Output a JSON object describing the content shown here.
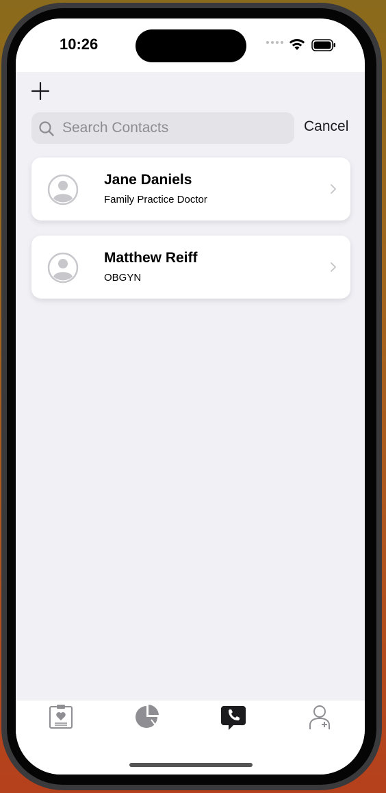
{
  "status": {
    "time": "10:26"
  },
  "search": {
    "placeholder": "Search Contacts",
    "cancel_label": "Cancel"
  },
  "contacts": [
    {
      "name": "Jane Daniels",
      "subtitle": "Family Practice Doctor"
    },
    {
      "name": "Matthew Reiff",
      "subtitle": "OBGYN"
    }
  ],
  "tabs": [
    {
      "icon": "clipboard-heart-icon",
      "active": false
    },
    {
      "icon": "pie-chart-icon",
      "active": false
    },
    {
      "icon": "phone-bubble-icon",
      "active": true
    },
    {
      "icon": "add-person-icon",
      "active": false
    }
  ],
  "colors": {
    "accent": "#000000",
    "background": "#f1f0f5",
    "inactive_tab": "#8e8e93"
  }
}
